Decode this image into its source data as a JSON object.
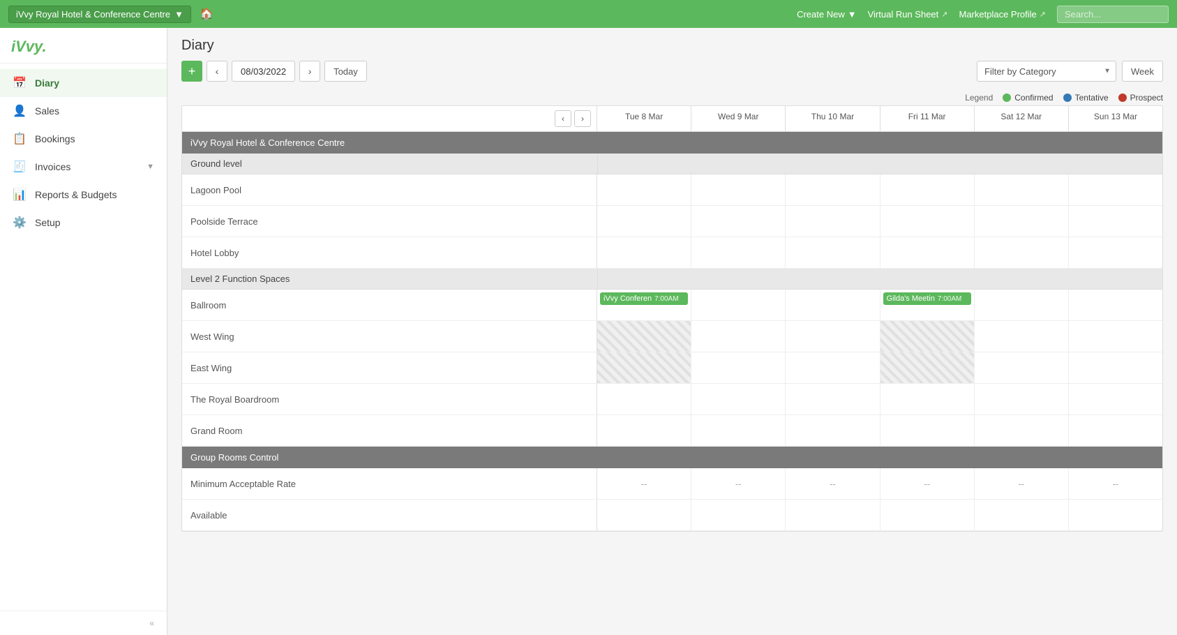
{
  "app": {
    "logo": "iVvy.",
    "accent_color": "#5cb85c"
  },
  "topnav": {
    "venue_name": "iVvy Royal Hotel & Conference Centre",
    "home_icon": "🏠",
    "create_new_label": "Create New",
    "virtual_run_sheet_label": "Virtual Run Sheet",
    "marketplace_profile_label": "Marketplace Profile",
    "search_placeholder": "Search..."
  },
  "sidebar": {
    "items": [
      {
        "id": "diary",
        "label": "Diary",
        "icon": "📅",
        "active": true
      },
      {
        "id": "sales",
        "label": "Sales",
        "icon": "👤"
      },
      {
        "id": "bookings",
        "label": "Bookings",
        "icon": "📋"
      },
      {
        "id": "invoices",
        "label": "Invoices",
        "icon": "🧾",
        "has_arrow": true
      },
      {
        "id": "reports",
        "label": "Reports & Budgets",
        "icon": "📊"
      },
      {
        "id": "setup",
        "label": "Setup",
        "icon": "⚙️"
      }
    ],
    "collapse_label": "«"
  },
  "diary": {
    "title": "Diary",
    "current_date": "08/03/2022",
    "today_label": "Today",
    "add_label": "+",
    "filter_placeholder": "Filter by Category",
    "view_label": "Week"
  },
  "legend": {
    "label": "Legend",
    "items": [
      {
        "id": "confirmed",
        "label": "Confirmed",
        "color": "#5cb85c"
      },
      {
        "id": "tentative",
        "label": "Tentative",
        "color": "#337ab7"
      },
      {
        "id": "prospect",
        "label": "Prospect",
        "color": "#c0392b"
      }
    ]
  },
  "calendar": {
    "venue_label": "iVvy Royal Hotel & Conference Centre",
    "days": [
      {
        "label": "Tue 8 Mar"
      },
      {
        "label": "Wed 9 Mar"
      },
      {
        "label": "Thu 10 Mar"
      },
      {
        "label": "Fri 11 Mar"
      },
      {
        "label": "Sat 12 Mar"
      },
      {
        "label": "Sun 13 Mar"
      }
    ],
    "sections": [
      {
        "type": "section",
        "label": "Ground level",
        "rows": [
          {
            "label": "Lagoon Pool",
            "cells": [
              "empty",
              "empty",
              "empty",
              "empty",
              "empty",
              "empty"
            ]
          },
          {
            "label": "Poolside Terrace",
            "cells": [
              "empty",
              "empty",
              "empty",
              "empty",
              "empty",
              "empty"
            ]
          },
          {
            "label": "Hotel Lobby",
            "cells": [
              "empty",
              "empty",
              "empty",
              "empty",
              "empty",
              "empty"
            ]
          }
        ]
      },
      {
        "type": "section",
        "label": "Level 2 Function Spaces",
        "rows": [
          {
            "label": "Ballroom",
            "cells": [
              {
                "type": "event",
                "name": "iVvy Conferen",
                "time": "7:00AM",
                "color": "#5cb85c"
              },
              "empty",
              "empty",
              {
                "type": "event",
                "name": "Gilda's Meetin",
                "time": "7:00AM",
                "color": "#5cb85c"
              },
              "empty",
              "empty"
            ]
          },
          {
            "label": "West Wing",
            "cells": [
              "striped",
              "empty",
              "empty",
              "striped",
              "empty",
              "empty"
            ]
          },
          {
            "label": "East Wing",
            "cells": [
              "striped",
              "empty",
              "empty",
              "striped",
              "empty",
              "empty"
            ]
          },
          {
            "label": "The Royal Boardroom",
            "cells": [
              "empty",
              "empty",
              "empty",
              "empty",
              "empty",
              "empty"
            ]
          },
          {
            "label": "Grand Room",
            "cells": [
              "empty",
              "empty",
              "empty",
              "empty",
              "empty",
              "empty"
            ]
          }
        ]
      },
      {
        "type": "section_dark",
        "label": "Group Rooms Control",
        "rows": [
          {
            "label": "Minimum Acceptable Rate",
            "cells": [
              "dash",
              "dash",
              "dash",
              "dash",
              "dash",
              "dash"
            ]
          },
          {
            "label": "Available",
            "cells": [
              "empty",
              "empty",
              "empty",
              "empty",
              "empty",
              "empty"
            ]
          }
        ]
      }
    ]
  }
}
